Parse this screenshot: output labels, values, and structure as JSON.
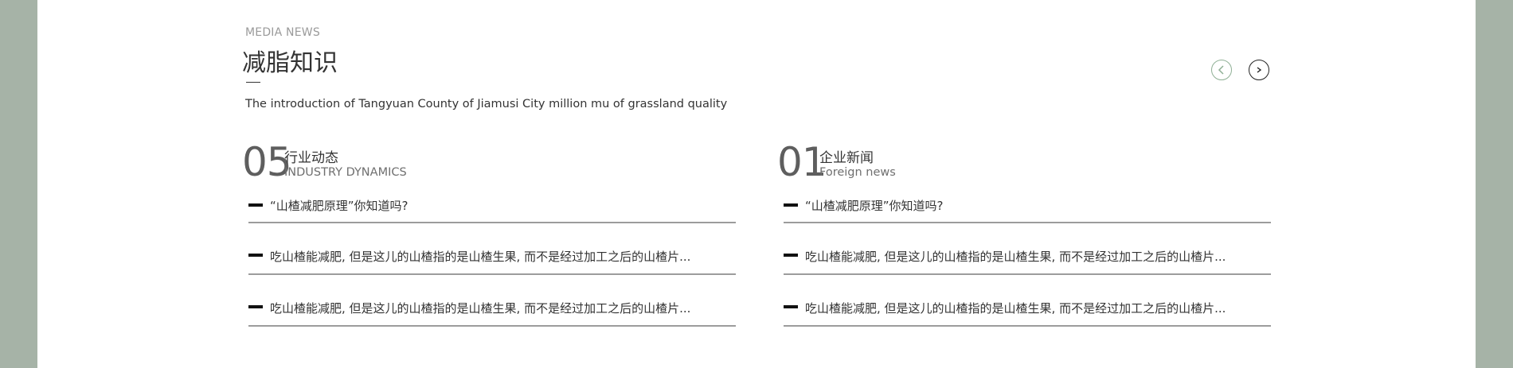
{
  "header": {
    "eyebrow": "MEDIA NEWS",
    "title": "减脂知识",
    "intro": "The introduction of Tangyuan County of Jiamusi City million mu of grassland quality"
  },
  "nav": {
    "prev_icon": "chevron-left-icon",
    "next_icon": "chevron-right-icon",
    "prev_color": "#8fb095",
    "next_color": "#222222"
  },
  "columns": [
    {
      "count": "05",
      "title_cn": "行业动态",
      "title_en": "INDUSTRY DYNAMICS",
      "items": [
        "“山楂减肥原理”你知道吗?",
        "吃山楂能减肥, 但是这儿的山楂指的是山楂生果, 而不是经过加工之后的山楂片...",
        "吃山楂能减肥, 但是这儿的山楂指的是山楂生果, 而不是经过加工之后的山楂片..."
      ]
    },
    {
      "count": "01",
      "title_cn": "企业新闻",
      "title_en": "Foreign news",
      "items": [
        "“山楂减肥原理”你知道吗?",
        "吃山楂能减肥, 但是这儿的山楂指的是山楂生果, 而不是经过加工之后的山楂片...",
        "吃山楂能减肥, 但是这儿的山楂指的是山楂生果, 而不是经过加工之后的山楂片..."
      ]
    }
  ],
  "colors": {
    "page_background": "#a6b3a7",
    "panel_background": "#ffffff",
    "text_primary": "#333333",
    "text_muted": "#9a9a9a"
  }
}
